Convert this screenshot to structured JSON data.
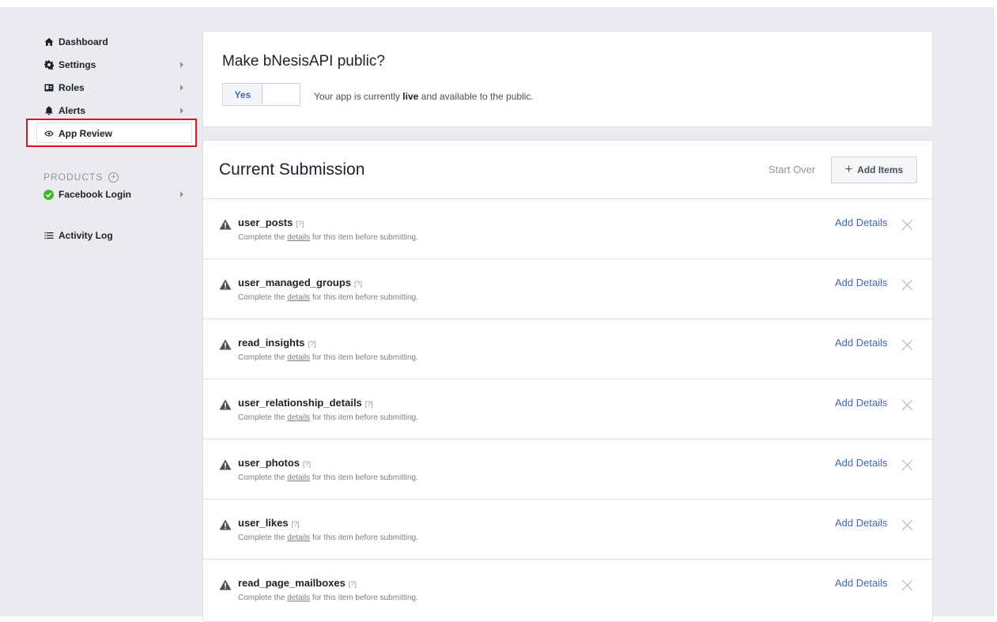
{
  "sidebar": {
    "items": [
      {
        "label": "Dashboard",
        "icon": "home-icon"
      },
      {
        "label": "Settings",
        "icon": "gear-icon"
      },
      {
        "label": "Roles",
        "icon": "id-card-icon"
      },
      {
        "label": "Alerts",
        "icon": "bell-icon"
      },
      {
        "label": "App Review",
        "icon": "eye-icon"
      }
    ],
    "products_label": "PRODUCTS",
    "products": [
      {
        "label": "Facebook Login",
        "icon": "check-circle-icon"
      }
    ],
    "activity_log": "Activity Log"
  },
  "public_panel": {
    "title": "Make bNesisAPI public?",
    "toggle_value": "Yes",
    "status_prefix": "Your app is currently ",
    "status_bold": "live",
    "status_suffix": " and available to the public."
  },
  "submission": {
    "title": "Current Submission",
    "start_over": "Start Over",
    "add_items": "Add Items",
    "add_details_label": "Add Details",
    "help_mark": "[?]",
    "desc_prefix": "Complete the ",
    "desc_link": "details",
    "desc_suffix": " for this item before submitting.",
    "items": [
      {
        "name": "user_posts"
      },
      {
        "name": "user_managed_groups"
      },
      {
        "name": "read_insights"
      },
      {
        "name": "user_relationship_details"
      },
      {
        "name": "user_photos"
      },
      {
        "name": "user_likes"
      },
      {
        "name": "read_page_mailboxes"
      }
    ]
  },
  "colors": {
    "accent": "#4267b2",
    "highlight_box": "#e0151b",
    "success": "#42b72a",
    "background": "#e9ebee"
  }
}
